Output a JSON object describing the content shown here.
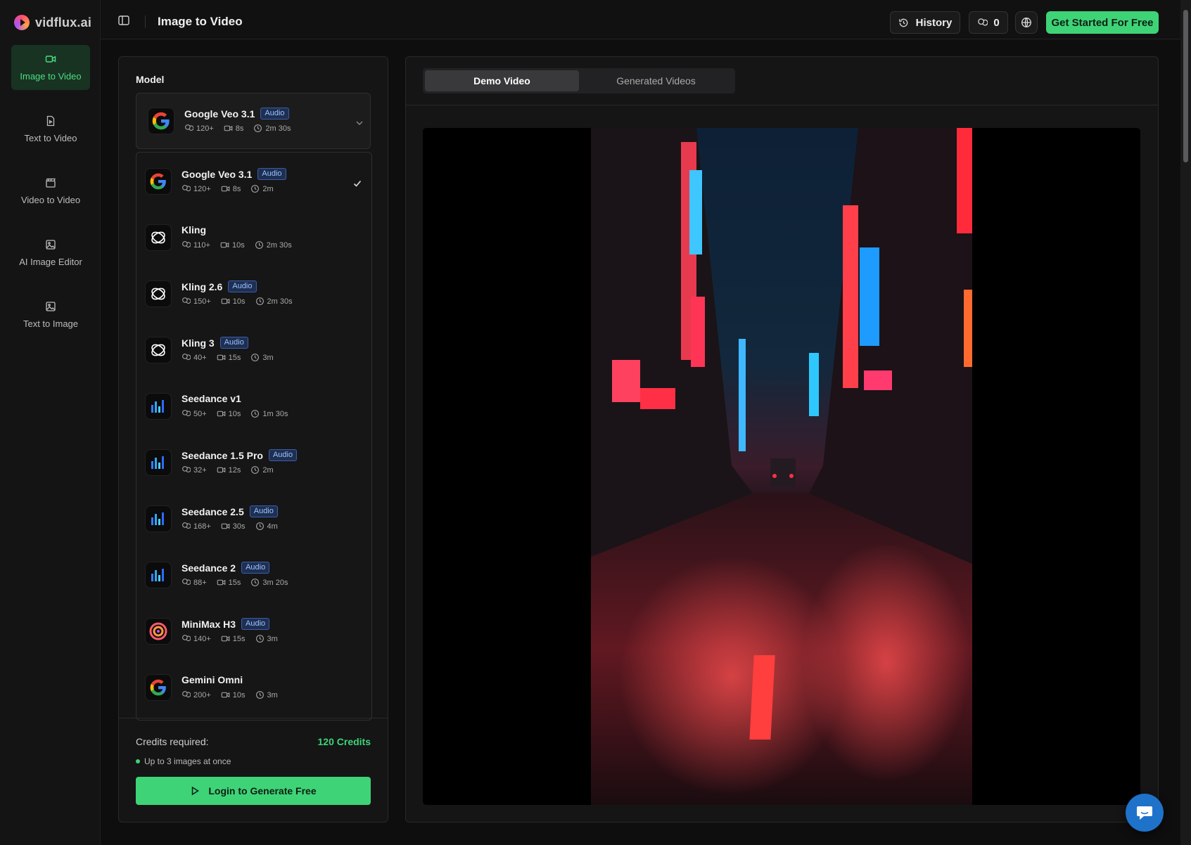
{
  "app": {
    "logo_text": "vidflux.ai"
  },
  "sidebar": {
    "items": [
      {
        "label": "Image to Video",
        "icon": "video-camera-icon",
        "active": true
      },
      {
        "label": "Text to Video",
        "icon": "document-icon",
        "active": false
      },
      {
        "label": "Video to Video",
        "icon": "clapper-icon",
        "active": false
      },
      {
        "label": "AI Image Editor",
        "icon": "image-icon",
        "active": false
      },
      {
        "label": "Text to Image",
        "icon": "image-icon",
        "active": false
      }
    ]
  },
  "header": {
    "title": "Image to Video",
    "history_label": "History",
    "credits_count": "0",
    "cta_label": "Get Started For Free"
  },
  "model_panel": {
    "label": "Model",
    "selected": {
      "name": "Google Veo 3.1",
      "badge": "Audio",
      "credits": "120+",
      "duration": "8s",
      "time": "2m 30s"
    },
    "options": [
      {
        "name": "Google Veo 3.1",
        "badge": "Audio",
        "credits": "120+",
        "duration": "8s",
        "time": "2m",
        "logo": "google",
        "checked": true
      },
      {
        "name": "Kling",
        "badge": "",
        "credits": "110+",
        "duration": "10s",
        "time": "2m 30s",
        "logo": "kling"
      },
      {
        "name": "Kling 2.6",
        "badge": "Audio",
        "credits": "150+",
        "duration": "10s",
        "time": "2m 30s",
        "logo": "kling"
      },
      {
        "name": "Kling 3",
        "badge": "Audio",
        "credits": "40+",
        "duration": "15s",
        "time": "3m",
        "logo": "kling"
      },
      {
        "name": "Seedance v1",
        "badge": "",
        "credits": "50+",
        "duration": "10s",
        "time": "1m 30s",
        "logo": "seedance"
      },
      {
        "name": "Seedance 1.5 Pro",
        "badge": "Audio",
        "credits": "32+",
        "duration": "12s",
        "time": "2m",
        "logo": "seedance"
      },
      {
        "name": "Seedance 2.5",
        "badge": "Audio",
        "credits": "168+",
        "duration": "30s",
        "time": "4m",
        "logo": "seedance"
      },
      {
        "name": "Seedance 2",
        "badge": "Audio",
        "credits": "88+",
        "duration": "15s",
        "time": "3m 20s",
        "logo": "seedance"
      },
      {
        "name": "MiniMax H3",
        "badge": "Audio",
        "credits": "140+",
        "duration": "15s",
        "time": "3m",
        "logo": "minimax"
      },
      {
        "name": "Gemini Omni",
        "badge": "",
        "credits": "200+",
        "duration": "10s",
        "time": "3m",
        "logo": "google"
      }
    ],
    "credits_required_label": "Credits required:",
    "credits_required_value": "120 Credits",
    "note": "Up to 3 images at once",
    "generate_label": "Login to Generate Free"
  },
  "preview": {
    "tabs": [
      {
        "label": "Demo Video",
        "active": true
      },
      {
        "label": "Generated Videos",
        "active": false
      }
    ]
  },
  "colors": {
    "accent": "#3fd377",
    "badge": "#1e2f52",
    "chat": "#1f72c9"
  }
}
